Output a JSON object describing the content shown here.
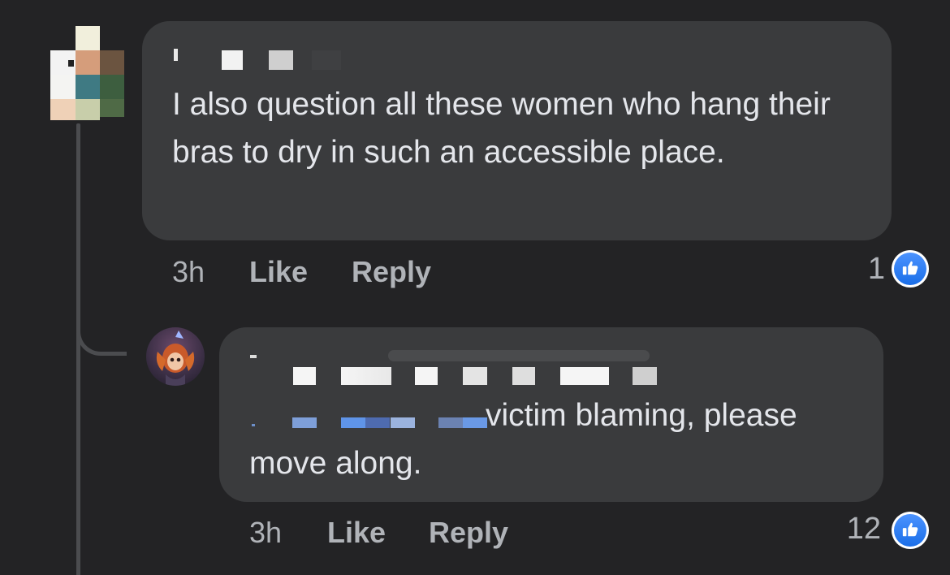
{
  "thread": {
    "comment": {
      "text": "I also question all these women who hang their bras to dry in such an accessible place.",
      "time": "3h",
      "like_label": "Like",
      "reply_label": "Reply",
      "reaction_count": "1",
      "reaction_icon": "thumbs-up-icon"
    },
    "reply": {
      "text_line1": "victim blaming, please",
      "text_line2": "move along.",
      "time": "3h",
      "like_label": "Like",
      "reply_label": "Reply",
      "reaction_count": "12",
      "reaction_icon": "thumbs-up-icon"
    }
  },
  "colors": {
    "background": "#232325",
    "bubble": "#3a3b3d",
    "text": "#e4e6eb",
    "meta": "#b0b3b8",
    "like_blue": "#1a6ee8"
  }
}
